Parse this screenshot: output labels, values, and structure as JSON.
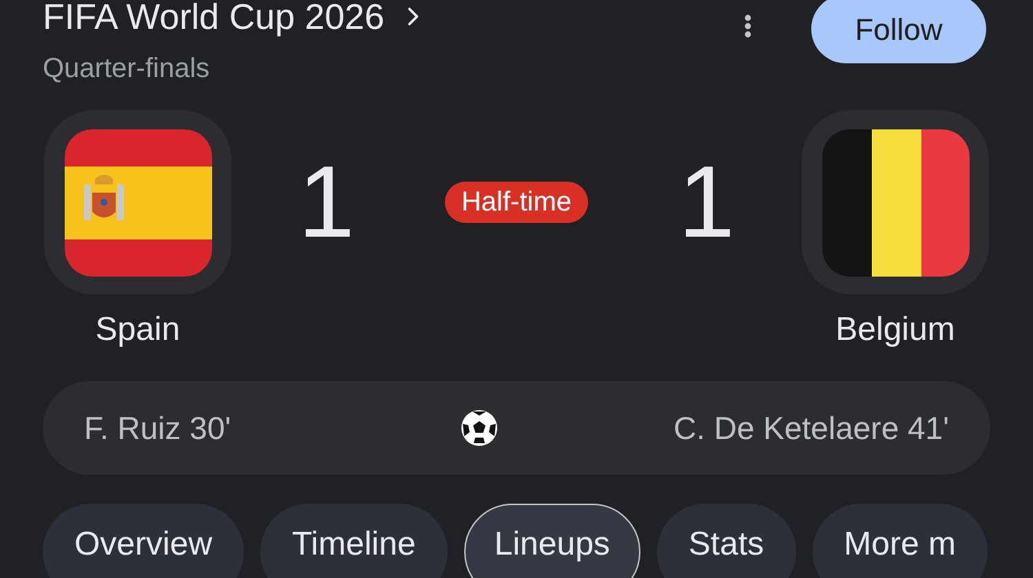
{
  "competition": {
    "title": "FIFA World Cup 2026",
    "round": "Quarter-finals",
    "follow_button": "Follow"
  },
  "match": {
    "status": "Half-time",
    "home": {
      "name": "Spain",
      "score": "1",
      "flag": {
        "kind": "spain"
      }
    },
    "away": {
      "name": "Belgium",
      "score": "1",
      "flag": {
        "kind": "belgium"
      }
    }
  },
  "goals": {
    "home": "F. Ruiz 30'",
    "away": "C. De Ketelaere 41'"
  },
  "tabs": [
    {
      "label": "Overview",
      "selected": false
    },
    {
      "label": "Timeline",
      "selected": false
    },
    {
      "label": "Lineups",
      "selected": true
    },
    {
      "label": "Stats",
      "selected": false
    },
    {
      "label": "More m",
      "selected": false
    }
  ]
}
